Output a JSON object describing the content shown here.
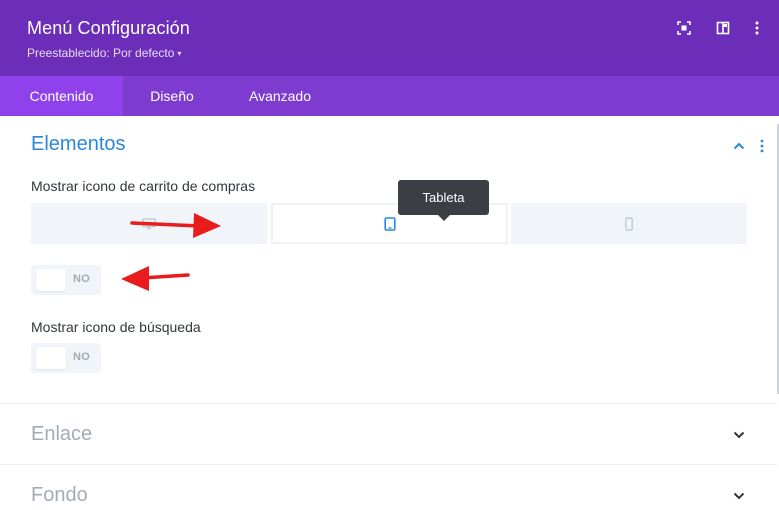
{
  "header": {
    "title": "Menú Configuración",
    "preset": "Preestablecido: Por defecto",
    "preset_caret": "▾",
    "icons": [
      "expand-icon",
      "sidebar-layout-icon",
      "more-vertical-icon"
    ]
  },
  "tabs": [
    {
      "label": "Contenido",
      "active": true
    },
    {
      "label": "Diseño",
      "active": false
    },
    {
      "label": "Avanzado",
      "active": false
    }
  ],
  "sections": {
    "elementos": {
      "title": "Elementos",
      "state": "expanded",
      "fields": {
        "cart_icon": {
          "label": "Mostrar icono de carrito de compras",
          "devices": [
            "desktop",
            "tablet",
            "phone"
          ],
          "active_device": "tablet",
          "tooltip": "Tableta",
          "toggle_value": "NO"
        },
        "search_icon": {
          "label": "Mostrar icono de búsqueda",
          "toggle_value": "NO"
        }
      }
    },
    "enlace": {
      "title": "Enlace",
      "state": "collapsed"
    },
    "fondo": {
      "title": "Fondo",
      "state": "collapsed"
    }
  },
  "colors": {
    "header_bg": "#6c2eb9",
    "tabs_bg": "#7e3bd0",
    "active_tab_bg": "#8f42ec",
    "accent_blue": "#2b87da",
    "annotation_red": "#e81c1c"
  }
}
